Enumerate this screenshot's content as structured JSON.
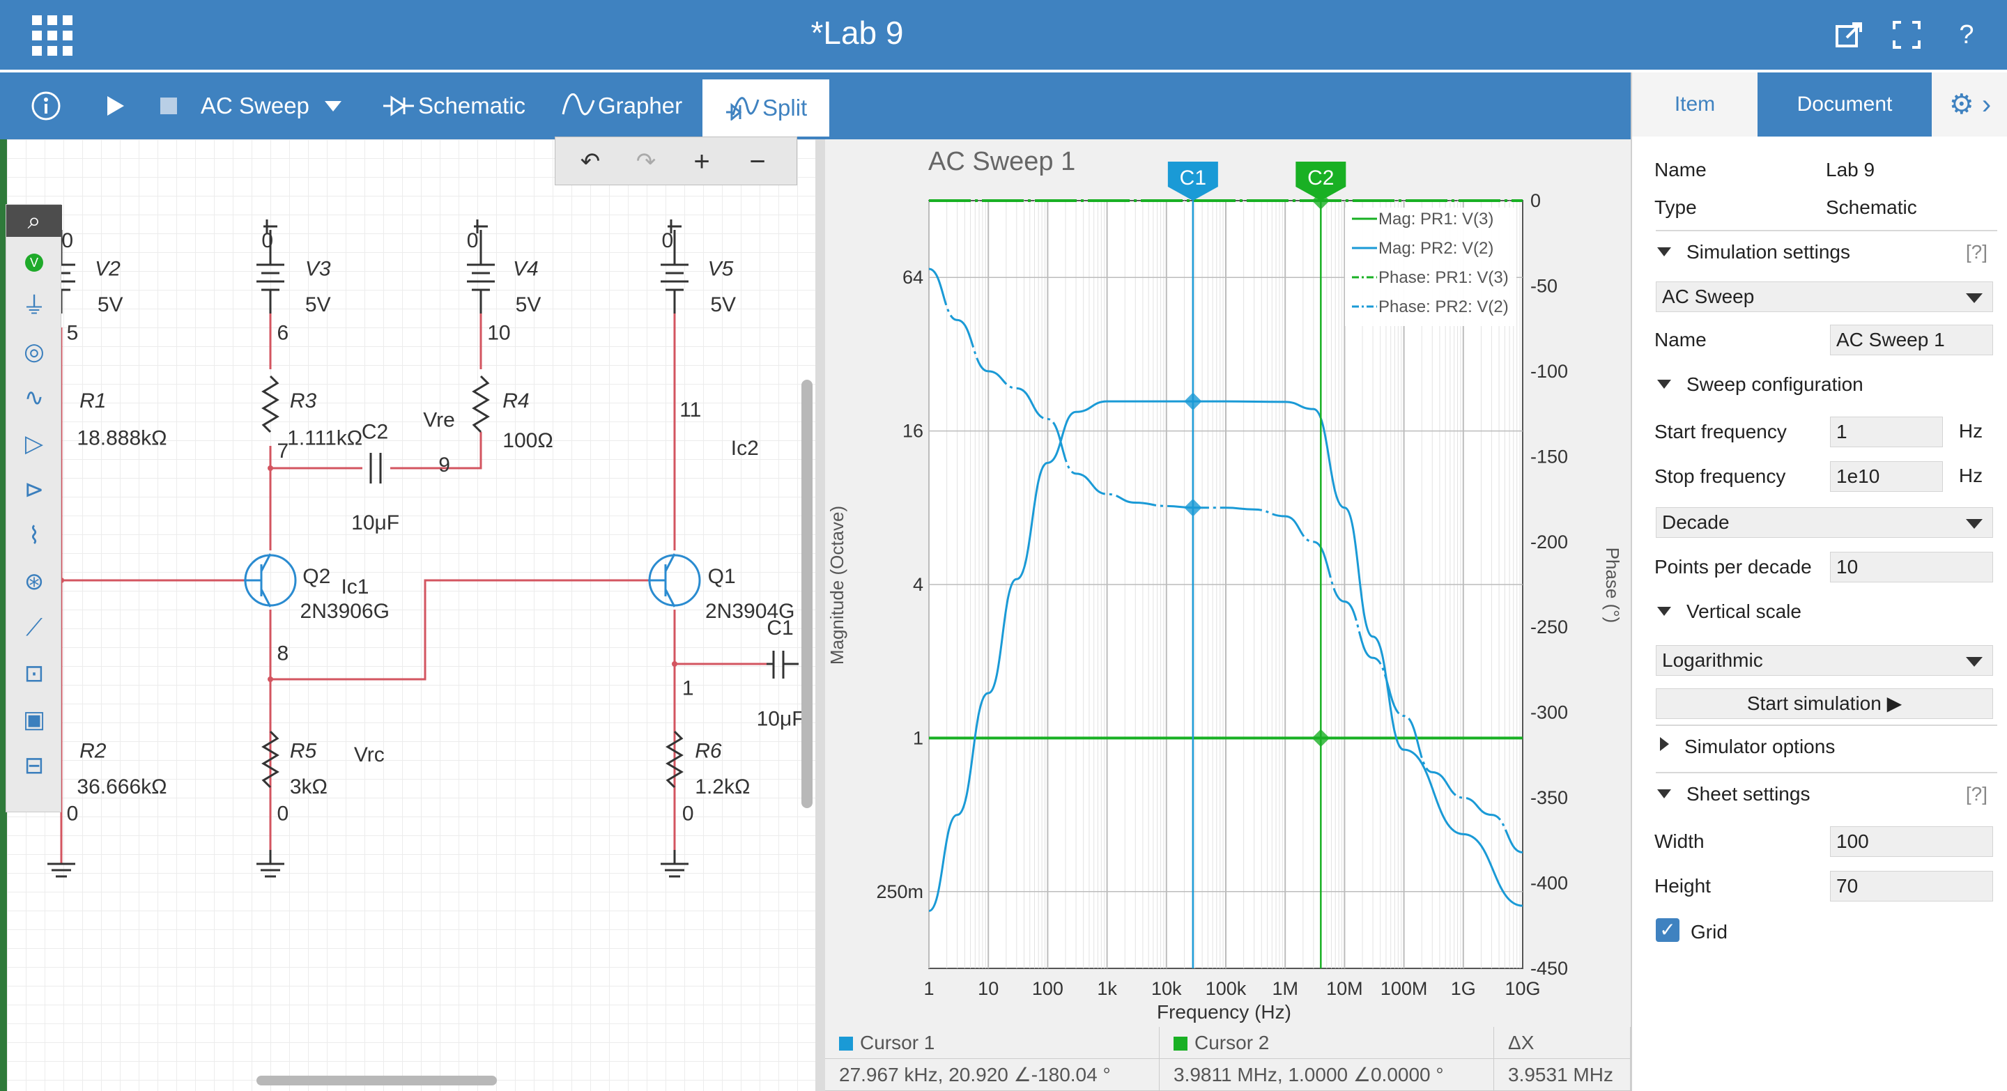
{
  "titlebar": {
    "title": "*Lab 9",
    "icons": [
      "grid-menu-icon",
      "pop-out-icon",
      "fullscreen-icon",
      "help-icon"
    ],
    "help_glyph": "?"
  },
  "toolbar": {
    "info_icon": "info-icon",
    "run_icon": "play-icon",
    "stop_icon": "stop-icon",
    "analysis": "AC Sweep",
    "tabs": [
      {
        "label": "Schematic",
        "icon": "schematic-icon"
      },
      {
        "label": "Grapher",
        "icon": "grapher-icon"
      },
      {
        "label": "Split",
        "icon": "split-icon",
        "active": true
      }
    ]
  },
  "zoom": {
    "undo_icon": "undo-icon",
    "redo_icon": "redo-icon",
    "zoom_in": "+",
    "zoom_out": "−"
  },
  "palette": [
    "search-icon",
    "probe-icon",
    "ground-icon",
    "ac-source-icon",
    "resistor-icon",
    "opamp-icon",
    "diode-icon",
    "transistor-icon",
    "lamp-icon",
    "switch-icon",
    "logic-block-icon",
    "ic-icon",
    "connector-icon"
  ],
  "schematic": {
    "labels": [
      {
        "t": "0"
      },
      {
        "t": "V2"
      },
      {
        "t": "5V"
      },
      {
        "t": "5"
      },
      {
        "t": "R1"
      },
      {
        "t": "18.888kΩ"
      },
      {
        "t": "R2"
      },
      {
        "t": "36.666kΩ"
      },
      {
        "t": "0"
      },
      {
        "t": "0"
      },
      {
        "t": "V3"
      },
      {
        "t": "5V"
      },
      {
        "t": "6"
      },
      {
        "t": "R3"
      },
      {
        "t": "1.111kΩ"
      },
      {
        "t": "C2"
      },
      {
        "t": "7"
      },
      {
        "t": "10μF"
      },
      {
        "t": "Q2"
      },
      {
        "t": "Ic1"
      },
      {
        "t": "2N3906G"
      },
      {
        "t": "8"
      },
      {
        "t": "R5"
      },
      {
        "t": "3kΩ"
      },
      {
        "t": "0"
      },
      {
        "t": "Vrc"
      },
      {
        "t": "0"
      },
      {
        "t": "V4"
      },
      {
        "t": "5V"
      },
      {
        "t": "10"
      },
      {
        "t": "Vre"
      },
      {
        "t": "R4"
      },
      {
        "t": "100Ω"
      },
      {
        "t": "9"
      },
      {
        "t": "0"
      },
      {
        "t": "V5"
      },
      {
        "t": "5V"
      },
      {
        "t": "11"
      },
      {
        "t": "Ic2"
      },
      {
        "t": "Q1"
      },
      {
        "t": "2N3904G"
      },
      {
        "t": "C1"
      },
      {
        "t": "1"
      },
      {
        "t": "10μF"
      },
      {
        "t": "R6"
      },
      {
        "t": "1.2kΩ"
      },
      {
        "t": "0"
      }
    ]
  },
  "chart_data": {
    "type": "line",
    "title": "AC Sweep 1",
    "xlabel": "Frequency (Hz)",
    "ylabel": "Magnitude (Octave)",
    "y2label": "Phase (°)",
    "x_scale": "log",
    "xlim": [
      1,
      10000000000
    ],
    "ylim": [
      0.125,
      128
    ],
    "y2lim": [
      -450,
      0
    ],
    "x_ticks": [
      "1",
      "10",
      "100",
      "1k",
      "10k",
      "100k",
      "1M",
      "10M",
      "100M",
      "1G",
      "10G"
    ],
    "y_ticks": [
      "64",
      "16",
      "4",
      "1",
      "250m"
    ],
    "y_tick_values": [
      64,
      16,
      4,
      1,
      0.25
    ],
    "y2_ticks": [
      "0",
      "-50",
      "-100",
      "-150",
      "-200",
      "-250",
      "-300",
      "-350",
      "-400",
      "-450"
    ],
    "grid": true,
    "legend_position": "top-right",
    "series": [
      {
        "name": "Mag: PR1: V(3)",
        "axis": "left",
        "style": "solid",
        "color": "#19b024",
        "x": [
          1,
          10000000000
        ],
        "y": [
          1,
          1
        ]
      },
      {
        "name": "Mag: PR2: V(2)",
        "axis": "left",
        "style": "solid",
        "color": "#1a9ad6",
        "x": [
          1,
          3,
          10,
          30,
          100,
          300,
          1000,
          3000,
          10000,
          100000,
          1000000,
          3000000,
          10000000,
          30000000,
          100000000,
          1000000000,
          10000000000
        ],
        "y": [
          0.21,
          0.5,
          1.5,
          4.2,
          12,
          19,
          20.9,
          20.9,
          20.9,
          20.9,
          20.8,
          19.5,
          8,
          2.5,
          0.9,
          0.42,
          0.22
        ]
      },
      {
        "name": "Phase: PR1: V(3)",
        "axis": "right",
        "style": "dashdot",
        "color": "#19b024",
        "x": [
          1,
          10000000000
        ],
        "y": [
          0,
          0
        ]
      },
      {
        "name": "Phase: PR2: V(2)",
        "axis": "right",
        "style": "dashdot",
        "color": "#1a9ad6",
        "x": [
          1,
          3,
          10,
          30,
          100,
          300,
          1000,
          3000,
          10000,
          30000,
          100000,
          300000,
          1000000,
          3000000,
          10000000,
          30000000,
          100000000,
          300000000,
          1000000000,
          3000000000,
          10000000000
        ],
        "y": [
          -40,
          -70,
          -100,
          -110,
          -128,
          -160,
          -172,
          -177,
          -179,
          -180,
          -180,
          -181,
          -185,
          -200,
          -235,
          -268,
          -302,
          -335,
          -350,
          -360,
          -382
        ]
      }
    ],
    "cursors": [
      {
        "label": "C1",
        "x": 27967,
        "color": "#1a9ad6"
      },
      {
        "label": "C2",
        "x": 3981100,
        "color": "#19b024"
      }
    ]
  },
  "cursorbar": {
    "c1_title": "Cursor 1",
    "c2_title": "Cursor 2",
    "dx_title": "ΔX",
    "c1_value": "27.967 kHz, 20.920 ∠-180.04 °",
    "c2_value": "3.9811 MHz, 1.0000 ∠0.0000 °",
    "dx_value": "3.9531 MHz",
    "c1_color": "#1a9ad6",
    "c2_color": "#19b024"
  },
  "panel": {
    "tab_item": "Item",
    "tab_document": "Document",
    "gear_icon": "gear-icon",
    "chevron_icon": "chevron-right-icon",
    "name_label": "Name",
    "name_value": "Lab 9",
    "type_label": "Type",
    "type_value": "Schematic",
    "sim_settings": "Simulation settings",
    "help": "[?]",
    "analysis_select": "AC Sweep",
    "sim_name_label": "Name",
    "sim_name_value": "AC Sweep 1",
    "sweep_config": "Sweep configuration",
    "start_label": "Start frequency",
    "start_value": "1",
    "start_unit": "Hz",
    "stop_label": "Stop frequency",
    "stop_value": "1e10",
    "stop_unit": "Hz",
    "scale_select": "Decade",
    "ppd_label": "Points per decade",
    "ppd_value": "10",
    "vscale": "Vertical scale",
    "vscale_select": "Logarithmic",
    "start_sim": "Start simulation ▶",
    "sim_options": "Simulator options",
    "sheet_settings": "Sheet settings",
    "width_label": "Width",
    "width_value": "100",
    "height_label": "Height",
    "height_value": "70",
    "grid_label": "Grid",
    "grid_checked": true
  }
}
